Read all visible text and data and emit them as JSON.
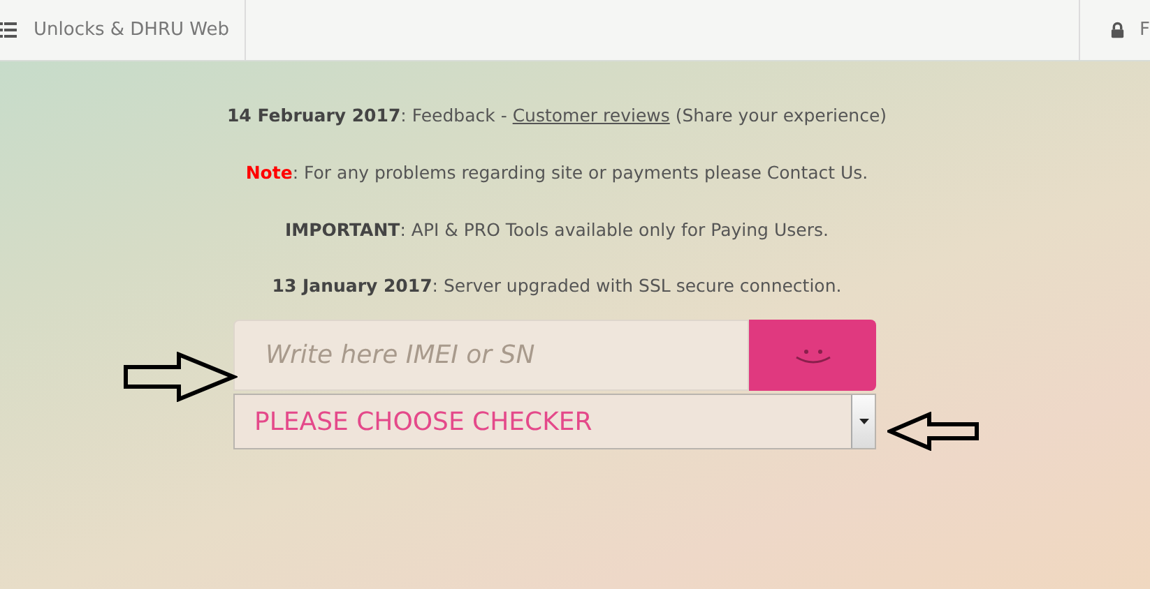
{
  "navbar": {
    "brand": "Unlocks & DHRU Web",
    "right_label": "F"
  },
  "notices": [
    {
      "kind": "link",
      "text": "**14 February 2017**: Feedback -",
      "link": "Customer reviews",
      "after": "(Share your experience)"
    },
    {
      "kind": "warning",
      "text": "**Note**: For any problems regarding site or payments please Contact Us."
    },
    {
      "kind": "plain",
      "text": "**IMPORTANT**: API & PRO Tools available only for Paying Users."
    },
    {
      "kind": "plain",
      "text": "**13 January 2017**: Server upgraded with SSL secure connection."
    }
  ],
  "form": {
    "imei_field": {
      "placeholder": "Write here IMEI or SN"
    },
    "checker_select": {
      "value": "PLEASE CHOOSE CHECKER"
    }
  }
}
